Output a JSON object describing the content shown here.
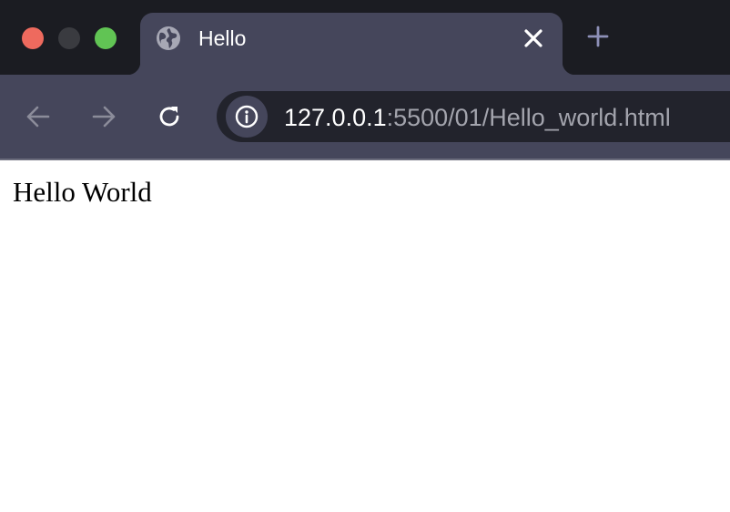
{
  "window_controls": {
    "close_color": "#ee6a5e",
    "minimize_color": "#3a3b40",
    "zoom_color": "#61c454"
  },
  "tab": {
    "title": "Hello",
    "favicon": "globe-icon",
    "close_icon": "close-icon"
  },
  "new_tab_icon": "plus-icon",
  "toolbar": {
    "back_icon": "arrow-left-icon",
    "forward_icon": "arrow-right-icon",
    "reload_icon": "reload-icon"
  },
  "address_bar": {
    "info_icon": "info-icon",
    "host": "127.0.0.1",
    "rest": ":5500/01/Hello_world.html"
  },
  "page": {
    "text": "Hello World"
  },
  "colors": {
    "tab_strip_bg": "#1b1c22",
    "toolbar_bg": "#45465b",
    "omnibox_bg": "#22232c",
    "url_muted": "#a3a4ad"
  }
}
